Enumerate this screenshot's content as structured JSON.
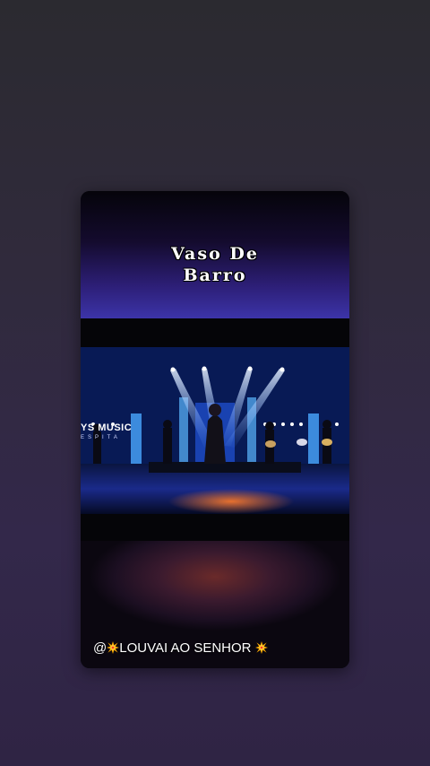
{
  "title": {
    "line1": "Vaso De",
    "line2": "Barro"
  },
  "video": {
    "overlay_text": "YS MUSIC",
    "overlay_subtext": "ESPITA"
  },
  "caption": {
    "prefix": "@",
    "text": "LOUVAI AO SENHOR",
    "burst_icon": "collision-emoji",
    "colors": {
      "burst_outer": "#f5a300",
      "burst_inner": "#ffe14d",
      "burst_core": "#ff3b1f"
    }
  },
  "colors": {
    "background": "#302a3c",
    "stage_blue": "#0b2a7a",
    "spotlight": "#cfe6ff"
  }
}
